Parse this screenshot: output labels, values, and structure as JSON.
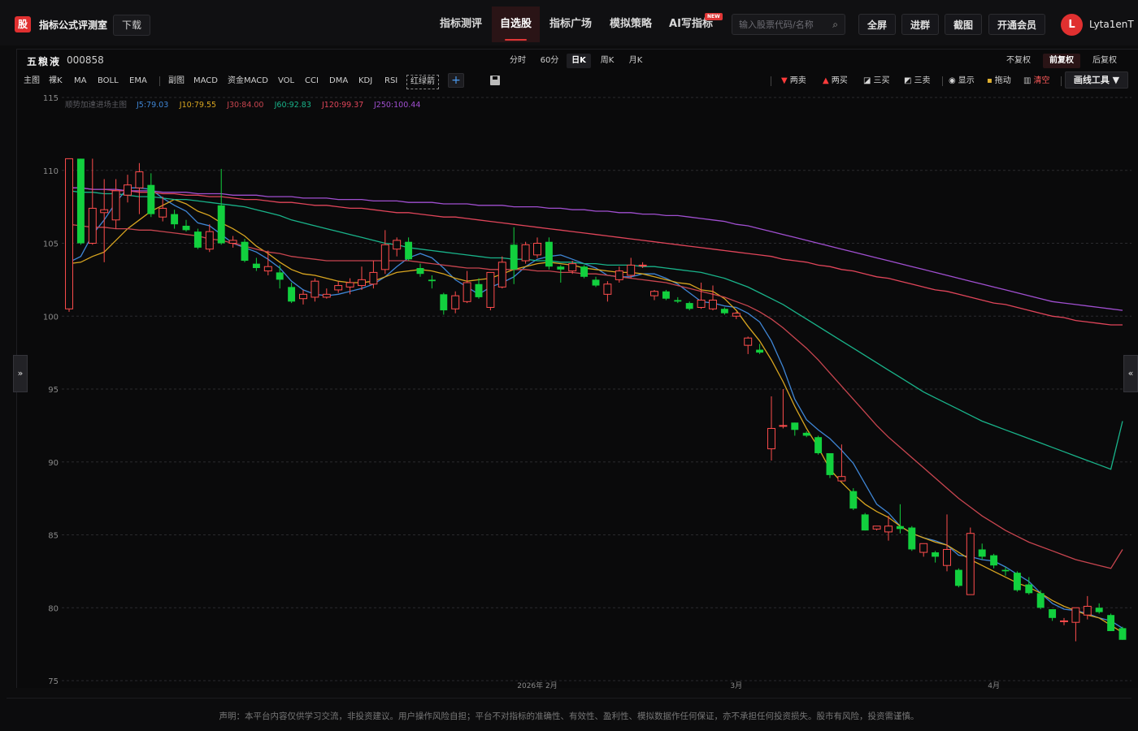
{
  "app": {
    "logo_glyph": "股",
    "brand": "指标公式评测室",
    "download": "下载"
  },
  "nav": [
    {
      "label": "指标测评",
      "active": false
    },
    {
      "label": "自选股",
      "active": true
    },
    {
      "label": "指标广场",
      "active": false
    },
    {
      "label": "模拟策略",
      "active": false
    },
    {
      "label": "AI写指标",
      "active": false,
      "badge": "NEW"
    }
  ],
  "search": {
    "placeholder": "输入股票代码/名称",
    "icon": "search-icon"
  },
  "top_actions": [
    "全屏",
    "进群",
    "截图",
    "开通会员"
  ],
  "user": {
    "initial": "L",
    "name": "Lyta1enT"
  },
  "stock": {
    "name": "五粮液",
    "code": "000858"
  },
  "periods": [
    {
      "label": "分时",
      "active": false
    },
    {
      "label": "60分",
      "active": false
    },
    {
      "label": "日K",
      "active": true
    },
    {
      "label": "周K",
      "active": false
    },
    {
      "label": "月K",
      "active": false
    }
  ],
  "adjust": [
    {
      "label": "不复权",
      "active": false
    },
    {
      "label": "前复权",
      "active": true
    },
    {
      "label": "后复权",
      "active": false
    }
  ],
  "indicators": {
    "main_label": "主图",
    "main": [
      "裸K",
      "MA",
      "BOLL",
      "EMA"
    ],
    "sub_label": "副图",
    "sub": [
      "MACD",
      "资金MACD",
      "VOL",
      "CCI",
      "DMA",
      "KDJ",
      "RSI",
      "红绿箭"
    ],
    "add": "+"
  },
  "tools": [
    {
      "label": "两卖",
      "icon": "triangle-down-icon",
      "color": "#ff3b3b"
    },
    {
      "label": "两买",
      "icon": "triangle-up-icon",
      "color": "#ff3b3b"
    },
    {
      "label": "三买",
      "icon": "chart-up-icon",
      "color": "#dddddd"
    },
    {
      "label": "三卖",
      "icon": "chart-down-icon",
      "color": "#dddddd"
    },
    {
      "label": "显示",
      "icon": "eye-icon",
      "color": "#dddddd"
    },
    {
      "label": "拖动",
      "icon": "lock-icon",
      "color": "#e0b030"
    },
    {
      "label": "清空",
      "icon": "trash-icon",
      "color": "#ff5a5a"
    }
  ],
  "draw_tools": "画线工具 ▼",
  "legend": {
    "title": "顺势加速进场主图",
    "items": [
      {
        "text": "J5:79.03",
        "color": "#3f86d6"
      },
      {
        "text": "J10:79.55",
        "color": "#d8a520"
      },
      {
        "text": "J30:84.00",
        "color": "#c8454f"
      },
      {
        "text": "J60:92.83",
        "color": "#19b38a"
      },
      {
        "text": "J120:99.37",
        "color": "#e0455a"
      },
      {
        "text": "J250:100.44",
        "color": "#a04fd0"
      }
    ]
  },
  "side_tabs": {
    "left": "»",
    "right": "«"
  },
  "disclaimer": "声明：本平台内容仅供学习交流，非投资建议。用户操作风险自担；平台不对指标的准确性、有效性、盈利性、模拟数据作任何保证，亦不承担任何投资损失。股市有风险，投资需谨慎。",
  "chart_data": {
    "type": "candlestick",
    "ylim": [
      75,
      115
    ],
    "yticks": [
      75,
      80,
      85,
      90,
      95,
      100,
      105,
      110,
      115
    ],
    "xlabels": [
      {
        "index": 40,
        "label": "2026年 2月"
      },
      {
        "index": 57,
        "label": "3月"
      },
      {
        "index": 79,
        "label": "4月"
      }
    ],
    "colors": {
      "up": "#ff4d4d",
      "down": "#12d03e",
      "grid": "#2a2a2e",
      "axis_text": "#8a8a8a"
    },
    "candles": [
      [
        100.5,
        110.8,
        100.3,
        110.8
      ],
      [
        110.8,
        110.8,
        104.9,
        105.0
      ],
      [
        105.0,
        110.8,
        104.9,
        107.4
      ],
      [
        107.1,
        109.4,
        103.7,
        107.3
      ],
      [
        106.6,
        109.4,
        106.0,
        108.6
      ],
      [
        108.3,
        109.7,
        107.8,
        109.0
      ],
      [
        108.8,
        110.5,
        107.0,
        109.9
      ],
      [
        109.0,
        109.8,
        106.8,
        107.0
      ],
      [
        106.8,
        108.2,
        106.5,
        107.4
      ],
      [
        107.0,
        107.3,
        106.0,
        106.3
      ],
      [
        106.2,
        106.6,
        105.8,
        105.9
      ],
      [
        105.8,
        106.0,
        104.6,
        104.7
      ],
      [
        104.6,
        106.3,
        104.4,
        105.8
      ],
      [
        107.6,
        110.1,
        104.9,
        105.0
      ],
      [
        105.0,
        105.5,
        104.7,
        105.2
      ],
      [
        105.1,
        105.3,
        103.7,
        103.8
      ],
      [
        103.6,
        104.0,
        103.1,
        103.3
      ],
      [
        103.1,
        104.5,
        102.8,
        103.4
      ],
      [
        103.0,
        103.5,
        101.9,
        102.5
      ],
      [
        102.0,
        102.3,
        100.9,
        101.0
      ],
      [
        101.2,
        101.8,
        100.8,
        101.5
      ],
      [
        101.3,
        102.6,
        101.0,
        102.4
      ],
      [
        101.3,
        101.9,
        101.2,
        101.5
      ],
      [
        101.8,
        102.4,
        101.6,
        102.1
      ],
      [
        102.0,
        102.6,
        101.5,
        102.3
      ],
      [
        102.1,
        103.4,
        101.8,
        102.5
      ],
      [
        102.2,
        103.8,
        101.9,
        103.0
      ],
      [
        103.2,
        105.9,
        102.9,
        104.9
      ],
      [
        104.6,
        105.4,
        104.1,
        105.2
      ],
      [
        105.1,
        105.4,
        103.8,
        103.9
      ],
      [
        103.3,
        103.6,
        102.7,
        102.9
      ],
      [
        102.5,
        102.8,
        101.9,
        102.4
      ],
      [
        101.5,
        101.6,
        100.1,
        100.4
      ],
      [
        100.5,
        101.7,
        100.2,
        101.4
      ],
      [
        101.0,
        103.1,
        100.9,
        102.3
      ],
      [
        102.2,
        102.6,
        101.2,
        101.3
      ],
      [
        100.6,
        103.0,
        100.4,
        103.0
      ],
      [
        102.0,
        104.1,
        101.9,
        103.7
      ],
      [
        104.9,
        106.1,
        102.2,
        103.2
      ],
      [
        103.8,
        105.1,
        103.6,
        104.9
      ],
      [
        104.2,
        105.4,
        104.0,
        105.0
      ],
      [
        105.1,
        105.4,
        103.2,
        103.4
      ],
      [
        103.4,
        103.5,
        102.3,
        103.2
      ],
      [
        103.1,
        103.8,
        102.9,
        103.6
      ],
      [
        103.4,
        103.5,
        102.6,
        102.7
      ],
      [
        102.5,
        102.7,
        102.0,
        102.1
      ],
      [
        101.5,
        102.4,
        101.0,
        102.2
      ],
      [
        102.5,
        103.4,
        102.3,
        103.1
      ],
      [
        102.8,
        104.0,
        102.6,
        103.5
      ],
      [
        103.5,
        103.7,
        103.3,
        103.5
      ],
      [
        101.4,
        101.8,
        101.1,
        101.7
      ],
      [
        101.7,
        101.8,
        101.1,
        101.2
      ],
      [
        101.1,
        101.3,
        100.9,
        101.0
      ],
      [
        100.9,
        101.0,
        100.4,
        100.5
      ],
      [
        100.6,
        102.3,
        100.5,
        101.1
      ],
      [
        100.5,
        102.1,
        100.4,
        101.1
      ],
      [
        100.5,
        100.6,
        100.1,
        100.2
      ],
      [
        100.0,
        100.3,
        99.8,
        100.2
      ],
      [
        98.0,
        98.6,
        97.4,
        98.5
      ],
      [
        97.7,
        98.1,
        97.4,
        97.5
      ],
      [
        90.9,
        94.5,
        90.1,
        92.3
      ],
      [
        92.5,
        95.0,
        92.3,
        92.5
      ],
      [
        92.7,
        92.7,
        91.8,
        92.2
      ],
      [
        92.0,
        92.1,
        91.7,
        91.8
      ],
      [
        91.7,
        91.8,
        90.5,
        90.6
      ],
      [
        90.6,
        90.6,
        88.9,
        89.1
      ],
      [
        88.7,
        91.2,
        88.7,
        89.0
      ],
      [
        88.0,
        88.2,
        86.7,
        86.8
      ],
      [
        86.4,
        86.5,
        85.3,
        85.3
      ],
      [
        85.4,
        85.6,
        85.3,
        85.6
      ],
      [
        85.2,
        86.3,
        84.6,
        85.6
      ],
      [
        85.6,
        87.1,
        85.1,
        85.4
      ],
      [
        85.5,
        85.6,
        83.9,
        84.0
      ],
      [
        83.8,
        84.4,
        83.5,
        84.4
      ],
      [
        83.8,
        83.9,
        83.1,
        83.5
      ],
      [
        82.9,
        86.4,
        82.5,
        84.0
      ],
      [
        82.6,
        82.7,
        81.4,
        81.5
      ],
      [
        80.9,
        85.5,
        80.9,
        85.1
      ],
      [
        84.0,
        84.4,
        83.3,
        83.5
      ],
      [
        83.6,
        83.7,
        82.7,
        82.9
      ],
      [
        82.6,
        82.8,
        82.2,
        82.5
      ],
      [
        82.4,
        82.5,
        81.1,
        81.2
      ],
      [
        81.6,
        82.1,
        80.9,
        81.0
      ],
      [
        81.0,
        81.2,
        79.9,
        80.0
      ],
      [
        79.9,
        79.9,
        79.1,
        79.3
      ],
      [
        79.1,
        79.3,
        78.8,
        79.1
      ],
      [
        79.0,
        80.0,
        77.7,
        80.0
      ],
      [
        79.5,
        80.8,
        79.2,
        80.1
      ],
      [
        80.0,
        80.3,
        79.6,
        79.7
      ],
      [
        79.5,
        79.6,
        78.4,
        78.4
      ],
      [
        78.6,
        78.7,
        77.8,
        77.8
      ]
    ],
    "series": [
      {
        "name": "J5",
        "color": "#3f86d6",
        "values": [
          103.7,
          104.1,
          105.6,
          106.6,
          107.8,
          108.8,
          108.8,
          108.7,
          108.1,
          107.6,
          107.2,
          106.4,
          106.2,
          105.6,
          105.0,
          104.7,
          104.4,
          103.9,
          103.3,
          102.4,
          101.8,
          101.5,
          101.4,
          101.5,
          101.7,
          101.9,
          102.2,
          102.7,
          103.4,
          104.0,
          104.3,
          104.0,
          103.3,
          102.5,
          102.0,
          101.5,
          102.0,
          102.3,
          102.7,
          103.4,
          103.9,
          104.1,
          104.2,
          103.9,
          103.6,
          103.3,
          102.8,
          102.7,
          102.7,
          102.9,
          102.9,
          102.6,
          102.2,
          101.6,
          101.0,
          100.9,
          100.7,
          100.6,
          100.2,
          99.6,
          98.3,
          96.5,
          94.3,
          92.9,
          92.2,
          91.6,
          90.8,
          89.9,
          88.5,
          87.1,
          86.5,
          85.6,
          85.1,
          84.8,
          84.6,
          84.3,
          83.6,
          83.5,
          83.3,
          83.2,
          82.8,
          82.3,
          81.8,
          81.0,
          80.3,
          79.9,
          79.8,
          79.6,
          79.3,
          79.1,
          78.6
        ]
      },
      {
        "name": "J10",
        "color": "#d8a520",
        "values": [
          103.6,
          103.7,
          104.1,
          104.4,
          105.2,
          106.0,
          106.6,
          107.2,
          107.6,
          108.0,
          107.7,
          107.2,
          106.9,
          106.4,
          106.0,
          105.5,
          104.8,
          104.3,
          103.7,
          103.2,
          102.9,
          102.8,
          102.6,
          102.4,
          102.3,
          102.3,
          102.4,
          102.7,
          103.0,
          103.1,
          103.2,
          103.1,
          102.9,
          102.6,
          102.4,
          102.5,
          102.6,
          102.9,
          103.2,
          103.4,
          103.6,
          103.7,
          103.6,
          103.5,
          103.3,
          103.2,
          103.1,
          103.0,
          103.0,
          102.9,
          102.7,
          102.5,
          102.3,
          102.2,
          101.8,
          101.7,
          101.2,
          100.4,
          99.3,
          98.3,
          97.0,
          95.5,
          93.8,
          92.3,
          91.0,
          89.5,
          88.6,
          87.8,
          87.1,
          86.6,
          86.2,
          85.6,
          85.1,
          84.8,
          84.5,
          84.3,
          83.8,
          83.3,
          82.9,
          82.5,
          82.1,
          81.7,
          81.4,
          81.0,
          80.5,
          80.1,
          79.8,
          79.5,
          79.3,
          78.8,
          78.3
        ]
      },
      {
        "name": "J30",
        "color": "#c8454f",
        "values": [
          106.3,
          106.2,
          106.1,
          106.1,
          106.0,
          106.0,
          105.9,
          105.9,
          105.8,
          105.7,
          105.6,
          105.5,
          105.3,
          105.2,
          105.0,
          104.8,
          104.6,
          104.4,
          104.3,
          104.1,
          104.0,
          103.9,
          103.8,
          103.8,
          103.8,
          103.8,
          103.8,
          103.8,
          103.8,
          103.8,
          103.7,
          103.6,
          103.5,
          103.4,
          103.3,
          103.3,
          103.2,
          103.2,
          103.2,
          103.2,
          103.1,
          103.1,
          103.0,
          103.0,
          102.9,
          102.9,
          102.8,
          102.7,
          102.6,
          102.5,
          102.4,
          102.3,
          102.1,
          101.9,
          101.7,
          101.5,
          101.3,
          101.0,
          100.7,
          100.3,
          99.8,
          99.2,
          98.5,
          97.8,
          97.0,
          96.1,
          95.2,
          94.3,
          93.4,
          92.5,
          91.7,
          91.0,
          90.3,
          89.6,
          88.9,
          88.2,
          87.5,
          86.9,
          86.3,
          85.8,
          85.3,
          84.9,
          84.5,
          84.2,
          83.9,
          83.6,
          83.3,
          83.1,
          82.9,
          82.7,
          84.0
        ]
      },
      {
        "name": "J60",
        "color": "#19b38a",
        "values": [
          108.6,
          108.5,
          108.5,
          108.4,
          108.4,
          108.3,
          108.2,
          108.2,
          108.1,
          108.0,
          108.0,
          107.9,
          107.8,
          107.7,
          107.6,
          107.5,
          107.3,
          107.1,
          106.9,
          106.6,
          106.4,
          106.2,
          106.0,
          105.8,
          105.6,
          105.4,
          105.2,
          105.0,
          104.9,
          104.7,
          104.6,
          104.5,
          104.4,
          104.3,
          104.2,
          104.1,
          104.0,
          104.0,
          103.9,
          103.9,
          103.8,
          103.8,
          103.7,
          103.7,
          103.6,
          103.6,
          103.5,
          103.5,
          103.5,
          103.4,
          103.4,
          103.3,
          103.2,
          103.1,
          103.0,
          102.8,
          102.6,
          102.3,
          102.0,
          101.6,
          101.2,
          100.8,
          100.3,
          99.8,
          99.3,
          98.8,
          98.3,
          97.8,
          97.3,
          96.8,
          96.3,
          95.8,
          95.3,
          94.8,
          94.4,
          94.0,
          93.6,
          93.2,
          92.8,
          92.5,
          92.2,
          91.9,
          91.6,
          91.3,
          91.0,
          90.7,
          90.4,
          90.1,
          89.8,
          89.5,
          92.8
        ]
      },
      {
        "name": "J120",
        "color": "#e0455a",
        "values": [
          108.8,
          108.8,
          108.7,
          108.7,
          108.6,
          108.6,
          108.5,
          108.5,
          108.4,
          108.4,
          108.3,
          108.3,
          108.2,
          108.2,
          108.1,
          108.0,
          108.0,
          107.9,
          107.8,
          107.8,
          107.7,
          107.6,
          107.6,
          107.5,
          107.4,
          107.4,
          107.3,
          107.2,
          107.1,
          107.1,
          107.0,
          106.9,
          106.8,
          106.8,
          106.7,
          106.6,
          106.5,
          106.4,
          106.3,
          106.2,
          106.1,
          106.0,
          105.9,
          105.8,
          105.7,
          105.6,
          105.5,
          105.4,
          105.3,
          105.2,
          105.1,
          105.0,
          104.9,
          104.8,
          104.7,
          104.6,
          104.5,
          104.4,
          104.3,
          104.2,
          104.1,
          103.9,
          103.8,
          103.7,
          103.5,
          103.4,
          103.2,
          103.1,
          102.9,
          102.7,
          102.6,
          102.4,
          102.2,
          102.0,
          101.8,
          101.7,
          101.5,
          101.3,
          101.1,
          100.9,
          100.8,
          100.6,
          100.4,
          100.2,
          100.0,
          99.9,
          99.7,
          99.6,
          99.5,
          99.4,
          99.4
        ]
      },
      {
        "name": "J250",
        "color": "#a04fd0",
        "values": [
          108.8,
          108.8,
          108.7,
          108.7,
          108.7,
          108.6,
          108.6,
          108.6,
          108.5,
          108.5,
          108.5,
          108.4,
          108.4,
          108.4,
          108.3,
          108.3,
          108.3,
          108.2,
          108.2,
          108.2,
          108.1,
          108.1,
          108.1,
          108.0,
          108.0,
          108.0,
          107.9,
          107.9,
          107.9,
          107.8,
          107.8,
          107.8,
          107.7,
          107.7,
          107.7,
          107.6,
          107.6,
          107.6,
          107.5,
          107.5,
          107.5,
          107.4,
          107.4,
          107.3,
          107.3,
          107.2,
          107.2,
          107.1,
          107.1,
          107.0,
          107.0,
          106.9,
          106.9,
          106.8,
          106.7,
          106.6,
          106.5,
          106.3,
          106.2,
          106.0,
          105.8,
          105.6,
          105.4,
          105.2,
          105.0,
          104.8,
          104.6,
          104.4,
          104.2,
          104.0,
          103.8,
          103.6,
          103.4,
          103.2,
          103.0,
          102.8,
          102.6,
          102.4,
          102.2,
          102.0,
          101.8,
          101.6,
          101.4,
          101.2,
          101.0,
          100.9,
          100.8,
          100.7,
          100.6,
          100.5,
          100.4
        ]
      }
    ]
  }
}
